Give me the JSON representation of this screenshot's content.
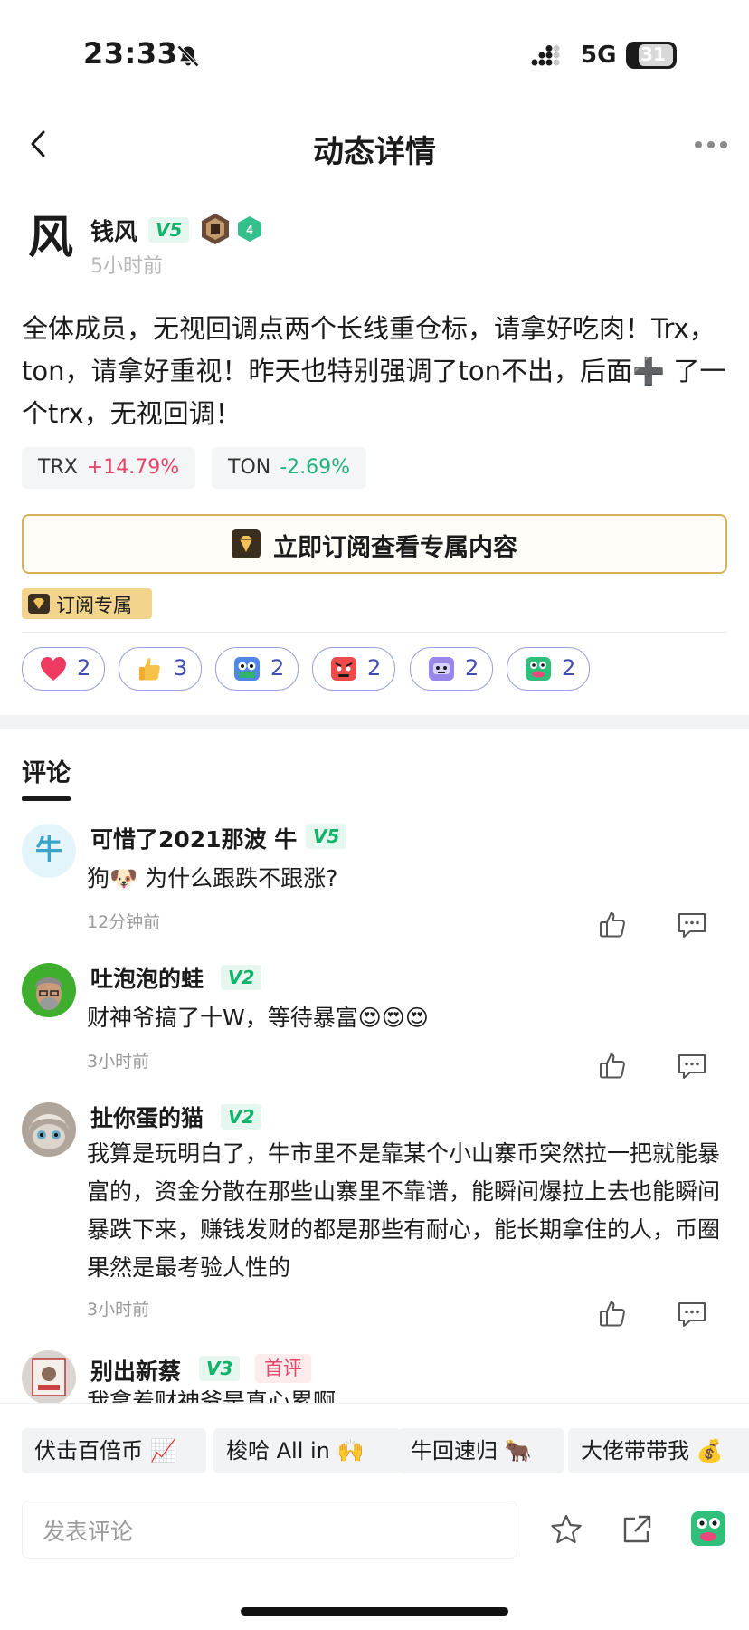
{
  "status_bar": {
    "time": "23:33",
    "network": "5G",
    "battery": "31"
  },
  "nav": {
    "title": "动态详情"
  },
  "post": {
    "author": {
      "avatar_char": "风",
      "name": "钱风",
      "level": "V5",
      "hex_badge": "4",
      "time": "5小时前"
    },
    "body": "全体成员，无视回调点两个长线重仓标，请拿好吃肉！Trx，ton，请拿好重视！昨天也特别强调了ton不出，后面➕ 了一个trx，无视回调！",
    "coins": [
      {
        "symbol": "TRX",
        "change": "+14.79%",
        "direction": "up"
      },
      {
        "symbol": "TON",
        "change": "-2.69%",
        "direction": "down"
      }
    ],
    "subscribe_button": "立即订阅查看专属内容",
    "exclusive_tag": "订阅专属",
    "reactions": [
      {
        "icon": "heart-icon",
        "count": "2"
      },
      {
        "icon": "thumbs-up-emoji-icon",
        "count": "3"
      },
      {
        "icon": "hodl-robot-icon",
        "count": "2"
      },
      {
        "icon": "angry-face-icon",
        "count": "2"
      },
      {
        "icon": "purple-robot-icon",
        "count": "2"
      },
      {
        "icon": "green-mascot-icon",
        "count": "2"
      }
    ]
  },
  "comments_title": "评论",
  "comments": [
    {
      "avatar_char": "牛",
      "name": "可惜了2021那波 牛",
      "level": "V5",
      "text": "狗🐶 为什么跟跌不跟涨?",
      "time": "12分钟前"
    },
    {
      "name": "吐泡泡的蛙",
      "level": "V2",
      "text": "财神爷搞了十W，等待暴富😍😍😍",
      "time": "3小时前"
    },
    {
      "name": "扯你蛋的猫",
      "level": "V2",
      "text": "我算是玩明白了，牛市里不是靠某个小山寨币突然拉一把就能暴富的，资金分散在那些山寨里不靠谱，能瞬间爆拉上去也能瞬间暴跌下来，赚钱发财的都是那些有耐心，能长期拿住的人，币圈果然是最考验人性的",
      "time": "3小时前"
    },
    {
      "name": "别出新蔡",
      "level": "V3",
      "tag": "首评",
      "text": "我拿着财神爷是真心累啊"
    }
  ],
  "quick_replies": [
    "伏击百倍币 📈",
    "梭哈 All in 🙌",
    "牛回速归 🐂",
    "大佬带带我 💰"
  ],
  "comment_input": {
    "placeholder": "发表评论"
  },
  "colors": {
    "up": "#e9456b",
    "down": "#1fb27a",
    "level_green": "#11b36a",
    "gold": "#d9b05a",
    "accent_blue": "#3e4cb0"
  }
}
